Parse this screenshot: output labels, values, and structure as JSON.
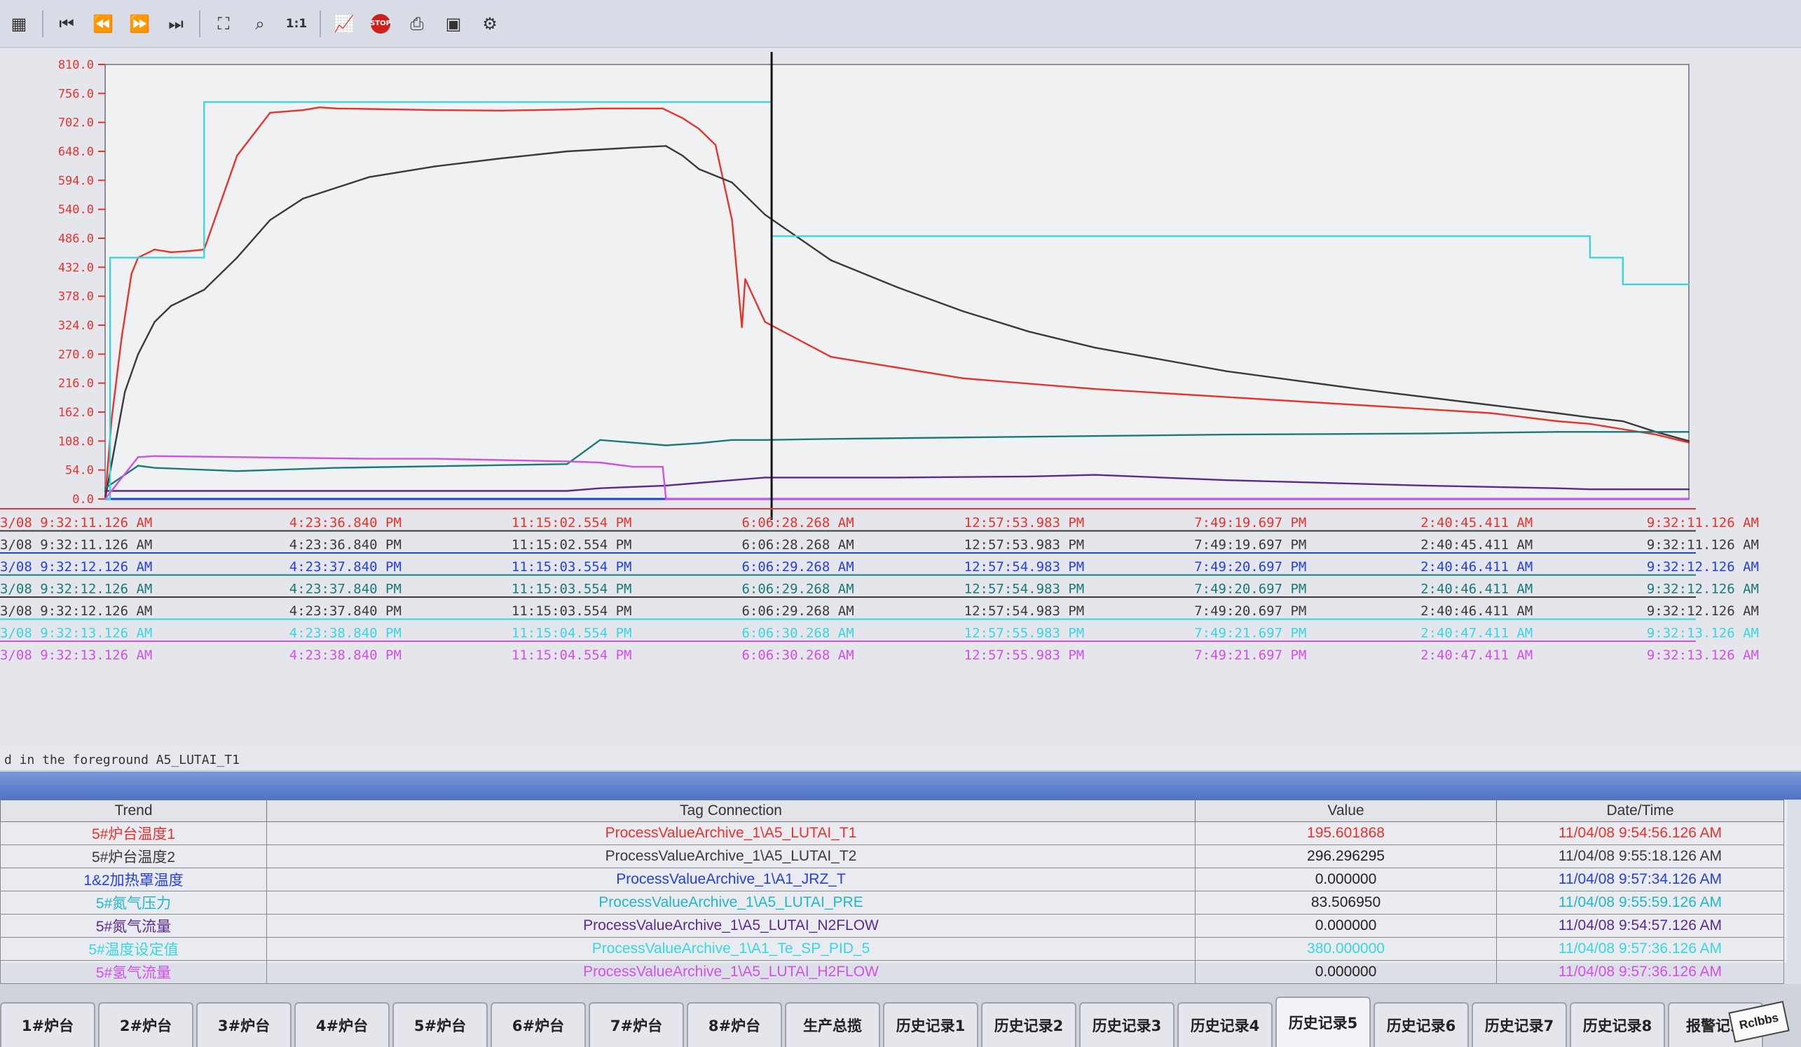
{
  "toolbar": {
    "icons": [
      "grid-icon",
      "first-icon",
      "rewind-icon",
      "forward-icon",
      "last-icon",
      "select-icon",
      "zoom-icon",
      "one-to-one-icon",
      "trend-icon",
      "stop-icon",
      "print-icon",
      "export-icon",
      "config-icon"
    ],
    "one_to_one": "1:1",
    "stop": "STOP"
  },
  "chart_data": {
    "type": "line",
    "y_ticks": [
      "810.0",
      "756.0",
      "702.0",
      "648.0",
      "594.0",
      "540.0",
      "486.0",
      "432.0",
      "378.0",
      "324.0",
      "270.0",
      "216.0",
      "162.0",
      "108.0",
      "54.0",
      "0.0"
    ],
    "ylim": [
      0,
      810
    ],
    "x_range_hours": [
      0,
      48
    ],
    "cursor_x": 20.2,
    "colors": {
      "red": "#e8322c",
      "black": "#3a3a3a",
      "blue": "#2540e0",
      "teal": "#1a7a78",
      "purple": "#5a2a90",
      "cyan": "#38d6e0",
      "magenta": "#d050e8"
    },
    "series": [
      {
        "x": [
          0,
          0.2,
          0.5,
          0.8,
          1,
          1.5,
          2,
          2.5,
          3,
          4,
          5,
          6,
          6.5,
          7,
          8,
          10,
          12,
          14,
          15,
          16,
          16.9,
          17.5,
          18,
          18.5,
          19,
          19.3,
          19.4,
          20,
          22,
          26,
          30,
          34,
          38,
          42,
          44,
          45,
          46,
          47,
          48
        ],
        "values": [
          0,
          150,
          300,
          420,
          450,
          465,
          460,
          462,
          465,
          640,
          720,
          725,
          730,
          728,
          727,
          725,
          724,
          726,
          728,
          728,
          728,
          710,
          690,
          660,
          520,
          320,
          410,
          330,
          265,
          225,
          205,
          190,
          175,
          160,
          145,
          140,
          130,
          120,
          105
        ]
      },
      {
        "x": [
          0,
          0.3,
          0.6,
          1,
          1.5,
          2,
          3,
          4,
          5,
          6,
          7,
          8,
          10,
          12,
          14,
          16,
          17,
          17.5,
          18,
          19,
          20,
          22,
          24,
          26,
          28,
          30,
          34,
          38,
          42,
          44,
          45,
          46,
          47,
          48
        ],
        "values": [
          0,
          100,
          200,
          270,
          330,
          360,
          390,
          450,
          520,
          560,
          580,
          600,
          620,
          635,
          648,
          655,
          658,
          640,
          615,
          590,
          530,
          445,
          395,
          350,
          312,
          282,
          238,
          205,
          175,
          160,
          152,
          145,
          125,
          108
        ]
      },
      {
        "x": [
          0,
          48
        ],
        "values": [
          0,
          0
        ]
      },
      {
        "x": [
          0,
          1,
          1.5,
          4,
          7,
          14,
          15,
          17,
          18,
          19,
          20,
          22,
          28,
          34,
          40,
          44,
          45,
          46,
          48
        ],
        "values": [
          20,
          62,
          58,
          52,
          58,
          65,
          110,
          100,
          104,
          110,
          110,
          112,
          116,
          120,
          122,
          125,
          125,
          125,
          125
        ]
      },
      {
        "x": [
          0,
          14,
          15,
          17,
          18,
          19,
          20,
          24,
          28,
          30,
          34,
          40,
          44,
          45,
          46,
          48
        ],
        "values": [
          15,
          15,
          20,
          25,
          30,
          35,
          40,
          40,
          42,
          45,
          35,
          25,
          20,
          18,
          18,
          18
        ]
      },
      {
        "x": [
          0,
          0.15,
          0.15,
          3,
          3,
          20.2,
          20.2,
          45,
          45,
          46,
          46,
          48
        ],
        "values": [
          0,
          0,
          450,
          450,
          740,
          740,
          490,
          490,
          450,
          450,
          400,
          400
        ]
      },
      {
        "x": [
          0,
          1,
          1.5,
          8,
          10,
          14,
          15,
          16,
          16.9,
          17,
          20,
          48
        ],
        "values": [
          0,
          78,
          80,
          75,
          75,
          70,
          68,
          60,
          60,
          0,
          0,
          0
        ]
      }
    ],
    "x_rows": [
      [
        "3/08  9:32:11.126 AM",
        "4:23:36.840 PM",
        "11:15:02.554 PM",
        "6:06:28.268 AM",
        "12:57:53.983 PM",
        "7:49:19.697 PM",
        "2:40:45.411 AM",
        "9:32:11.126 AM"
      ],
      [
        "3/08  9:32:11.126 AM",
        "4:23:36.840 PM",
        "11:15:02.554 PM",
        "6:06:28.268 AM",
        "12:57:53.983 PM",
        "7:49:19.697 PM",
        "2:40:45.411 AM",
        "9:32:11.126 AM"
      ],
      [
        "3/08  9:32:12.126 AM",
        "4:23:37.840 PM",
        "11:15:03.554 PM",
        "6:06:29.268 AM",
        "12:57:54.983 PM",
        "7:49:20.697 PM",
        "2:40:46.411 AM",
        "9:32:12.126 AM"
      ],
      [
        "3/08  9:32:12.126 AM",
        "4:23:37.840 PM",
        "11:15:03.554 PM",
        "6:06:29.268 AM",
        "12:57:54.983 PM",
        "7:49:20.697 PM",
        "2:40:46.411 AM",
        "9:32:12.126 AM"
      ],
      [
        "3/08  9:32:12.126 AM",
        "4:23:37.840 PM",
        "11:15:03.554 PM",
        "6:06:29.268 AM",
        "12:57:54.983 PM",
        "7:49:20.697 PM",
        "2:40:46.411 AM",
        "9:32:12.126 AM"
      ],
      [
        "3/08  9:32:13.126 AM",
        "4:23:38.840 PM",
        "11:15:04.554 PM",
        "6:06:30.268 AM",
        "12:57:55.983 PM",
        "7:49:21.697 PM",
        "2:40:47.411 AM",
        "9:32:13.126 AM"
      ],
      [
        "3/08  9:32:13.126 AM",
        "4:23:38.840 PM",
        "11:15:04.554 PM",
        "6:06:30.268 AM",
        "12:57:55.983 PM",
        "7:49:21.697 PM",
        "2:40:47.411 AM",
        "9:32:13.126 AM"
      ]
    ],
    "x_row_colors": [
      "red",
      "black",
      "blue",
      "teal",
      "black",
      "cyan",
      "magenta"
    ]
  },
  "status": "d in the foreground A5_LUTAI_T1",
  "table": {
    "headers": [
      "Trend",
      "Tag Connection",
      "Value",
      "Date/Time"
    ],
    "rows": [
      {
        "trend": "5#炉台温度1",
        "tag": "ProcessValueArchive_1\\A5_LUTAI_T1",
        "value": "195.601868",
        "time": "11/04/08 9:54:56.126 AM",
        "color": "#e8322c"
      },
      {
        "trend": "5#炉台温度2",
        "tag": "ProcessValueArchive_1\\A5_LUTAI_T2",
        "value": "296.296295",
        "time": "11/04/08 9:55:18.126 AM",
        "color": "#3a3a3a"
      },
      {
        "trend": "1&2加热罩温度",
        "tag": "ProcessValueArchive_1\\A1_JRZ_T",
        "value": "0.000000",
        "time": "11/04/08 9:57:34.126 AM",
        "color": "#2540e0"
      },
      {
        "trend": "5#氮气压力",
        "tag": "ProcessValueArchive_1\\A5_LUTAI_PRE",
        "value": "83.506950",
        "time": "11/04/08 9:55:59.126 AM",
        "color": "#1fb8c8"
      },
      {
        "trend": "5#氮气流量",
        "tag": "ProcessValueArchive_1\\A5_LUTAI_N2FLOW",
        "value": "0.000000",
        "time": "11/04/08 9:54:57.126 AM",
        "color": "#5a2a90"
      },
      {
        "trend": "5#温度设定值",
        "tag": "ProcessValueArchive_1\\A1_Te_SP_PID_5",
        "value": "380.000000",
        "time": "11/04/08 9:57:36.126 AM",
        "color": "#38d6e0"
      },
      {
        "trend": "5#氢气流量",
        "tag": "ProcessValueArchive_1\\A5_LUTAI_H2FLOW",
        "value": "0.000000",
        "time": "11/04/08 9:57:36.126 AM",
        "color": "#d050e8"
      }
    ]
  },
  "tabs": [
    "1#炉台",
    "2#炉台",
    "3#炉台",
    "4#炉台",
    "5#炉台",
    "6#炉台",
    "7#炉台",
    "8#炉台",
    "生产总揽",
    "历史记录1",
    "历史记录2",
    "历史记录3",
    "历史记录4",
    "历史记录5",
    "历史记录6",
    "历史记录7",
    "历史记录8",
    "报警记录"
  ],
  "active_tab": 13,
  "watermark": "Rclbbs"
}
